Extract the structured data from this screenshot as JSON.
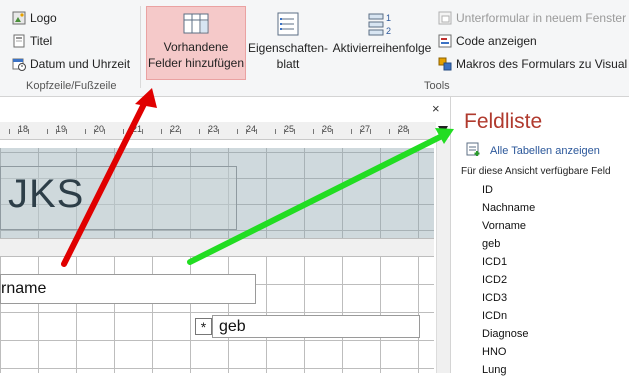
{
  "ribbon": {
    "header_footer_group": {
      "label": "Kopfzeile/Fußzeile",
      "logo": "Logo",
      "title": "Titel",
      "datetime": "Datum und Uhrzeit"
    },
    "tools_group": {
      "label": "Tools",
      "add_fields_line1": "Vorhandene",
      "add_fields_line2": "Felder hinzufügen",
      "property_sheet_line1": "Eigenschaften-",
      "property_sheet_line2": "blatt",
      "tab_order": "Aktivierreihenfolge",
      "subform_new_window": "Unterformular in neuem Fenster",
      "view_code": "Code anzeigen",
      "convert_macros": "Makros des Formulars zu Visual B"
    }
  },
  "designer": {
    "close": "×",
    "ruler_labels": [
      "18",
      "19",
      "20",
      "21",
      "22",
      "23",
      "24",
      "25",
      "26",
      "27",
      "28"
    ],
    "form_title": "JKS",
    "field_nachname": "rname",
    "field_geb": "geb",
    "asterisk": "*"
  },
  "field_list": {
    "title": "Feldliste",
    "show_all_tables": "Alle Tabellen anzeigen",
    "caption": "Für diese Ansicht verfügbare Feld",
    "fields": [
      "ID",
      "Nachname",
      "Vorname",
      "geb",
      "ICD1",
      "ICD2",
      "ICD3",
      "ICDn",
      "Diagnose",
      "HNO",
      "Lung"
    ]
  },
  "annotations": {
    "red_arrow_color": "#e00000",
    "green_arrow_color": "#22dd22"
  }
}
